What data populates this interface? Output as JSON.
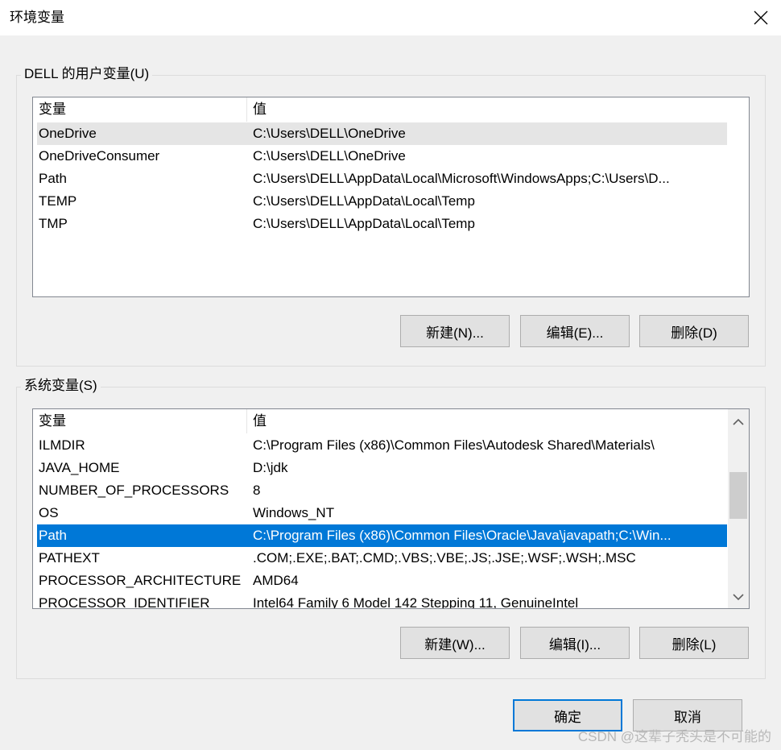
{
  "window": {
    "title": "环境变量",
    "close_icon": "close-icon"
  },
  "user_section": {
    "title": "DELL 的用户变量(U)",
    "columns": [
      "变量",
      "值"
    ],
    "rows": [
      {
        "name": "OneDrive",
        "value": "C:\\Users\\DELL\\OneDrive"
      },
      {
        "name": "OneDriveConsumer",
        "value": "C:\\Users\\DELL\\OneDrive"
      },
      {
        "name": "Path",
        "value": "C:\\Users\\DELL\\AppData\\Local\\Microsoft\\WindowsApps;C:\\Users\\D..."
      },
      {
        "name": "TEMP",
        "value": "C:\\Users\\DELL\\AppData\\Local\\Temp"
      },
      {
        "name": "TMP",
        "value": "C:\\Users\\DELL\\AppData\\Local\\Temp"
      }
    ],
    "buttons": {
      "new": "新建(N)...",
      "edit": "编辑(E)...",
      "delete": "删除(D)"
    }
  },
  "system_section": {
    "title": "系统变量(S)",
    "columns": [
      "变量",
      "值"
    ],
    "rows": [
      {
        "name": "ILMDIR",
        "value": "C:\\Program Files (x86)\\Common Files\\Autodesk Shared\\Materials\\"
      },
      {
        "name": "JAVA_HOME",
        "value": "D:\\jdk"
      },
      {
        "name": "NUMBER_OF_PROCESSORS",
        "value": "8"
      },
      {
        "name": "OS",
        "value": "Windows_NT"
      },
      {
        "name": "Path",
        "value": "C:\\Program Files (x86)\\Common Files\\Oracle\\Java\\javapath;C:\\Win..."
      },
      {
        "name": "PATHEXT",
        "value": ".COM;.EXE;.BAT;.CMD;.VBS;.VBE;.JS;.JSE;.WSF;.WSH;.MSC"
      },
      {
        "name": "PROCESSOR_ARCHITECTURE",
        "value": "AMD64"
      },
      {
        "name": "PROCESSOR_IDENTIFIER",
        "value": "Intel64 Family 6 Model 142 Stepping 11, GenuineIntel"
      }
    ],
    "buttons": {
      "new": "新建(W)...",
      "edit": "编辑(I)...",
      "delete": "删除(L)"
    }
  },
  "footer": {
    "ok": "确定",
    "cancel": "取消"
  },
  "watermark": "CSDN @这辈子秃头是不可能的",
  "colors": {
    "selection": "#0078d7",
    "hover": "#e5e5e5"
  }
}
